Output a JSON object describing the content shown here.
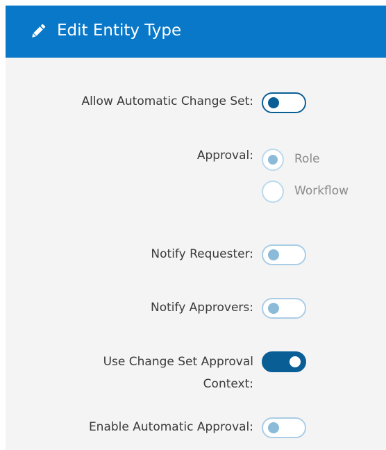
{
  "header": {
    "title": "Edit Entity Type",
    "icon": "pencil-icon"
  },
  "fields": {
    "allow_automatic_change_set": {
      "label": "Allow Automatic Change Set:",
      "value": false,
      "enabled": true
    },
    "approval": {
      "label": "Approval:",
      "options": [
        "Role",
        "Workflow"
      ],
      "selected": "Role",
      "enabled": false
    },
    "notify_requester": {
      "label": "Notify Requester:",
      "value": false,
      "enabled": false
    },
    "notify_approvers": {
      "label": "Notify Approvers:",
      "value": false,
      "enabled": false
    },
    "use_change_set_approval_context": {
      "label": "Use Change Set Approval Context:",
      "value": true,
      "enabled": true
    },
    "enable_automatic_approval": {
      "label": "Enable Automatic Approval:",
      "value": false,
      "enabled": false
    }
  },
  "colors": {
    "header_bg": "#0a78c8",
    "accent": "#0a5e96",
    "disabled_accent": "#8cbbd9",
    "panel_bg": "#f4f4f4"
  }
}
